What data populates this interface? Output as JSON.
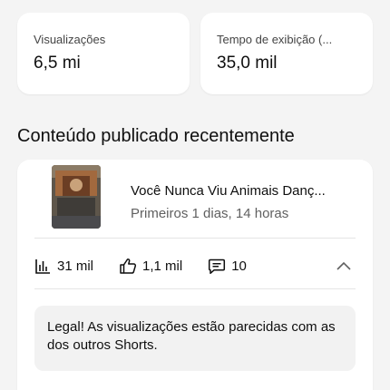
{
  "stats": [
    {
      "label": "Visualizações",
      "value": "6,5 mi"
    },
    {
      "label": "Tempo de exibição (...",
      "value": "35,0 mil"
    }
  ],
  "section": {
    "title": "Conteúdo publicado recentemente"
  },
  "video": {
    "title": "Você Nunca Viu Animais Danç...",
    "subtitle": "Primeiros 1 dias, 14 horas",
    "views": "31 mil",
    "likes": "1,1 mil",
    "comments": "10"
  },
  "tip": {
    "text": "Legal! As visualizações estão parecidas com as dos outros Shorts."
  },
  "icons": {
    "views": "bar-chart-icon",
    "likes": "thumbs-up-icon",
    "comments": "comment-icon",
    "collapse": "chevron-up-icon"
  }
}
